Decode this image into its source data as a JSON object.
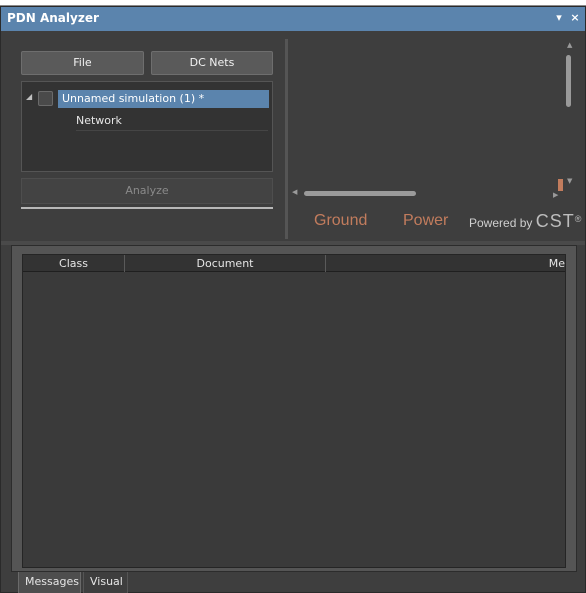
{
  "window": {
    "title": "PDN Analyzer",
    "pin_icon": "▾",
    "close_icon": "×"
  },
  "toolbar": {
    "file_label": "File",
    "dcnets_label": "DC Nets",
    "analyze_label": "Analyze"
  },
  "tree": {
    "simulation_label": "Unnamed simulation (1) *",
    "child_label": "Network",
    "expand_icon": "◢"
  },
  "preview": {
    "ground_label": "Ground",
    "power_label": "Power",
    "powered_by": "Powered by",
    "brand": "CST",
    "registered": "®"
  },
  "messages": {
    "columns": [
      "Class",
      "Document",
      "Me"
    ]
  },
  "tabs": [
    {
      "label": "Messages"
    },
    {
      "label": "Visual"
    }
  ],
  "colors": {
    "accent": "#5b84ad",
    "ground": "#c27c5d",
    "power": "#c27c5d",
    "background": "#3e3e3e"
  }
}
